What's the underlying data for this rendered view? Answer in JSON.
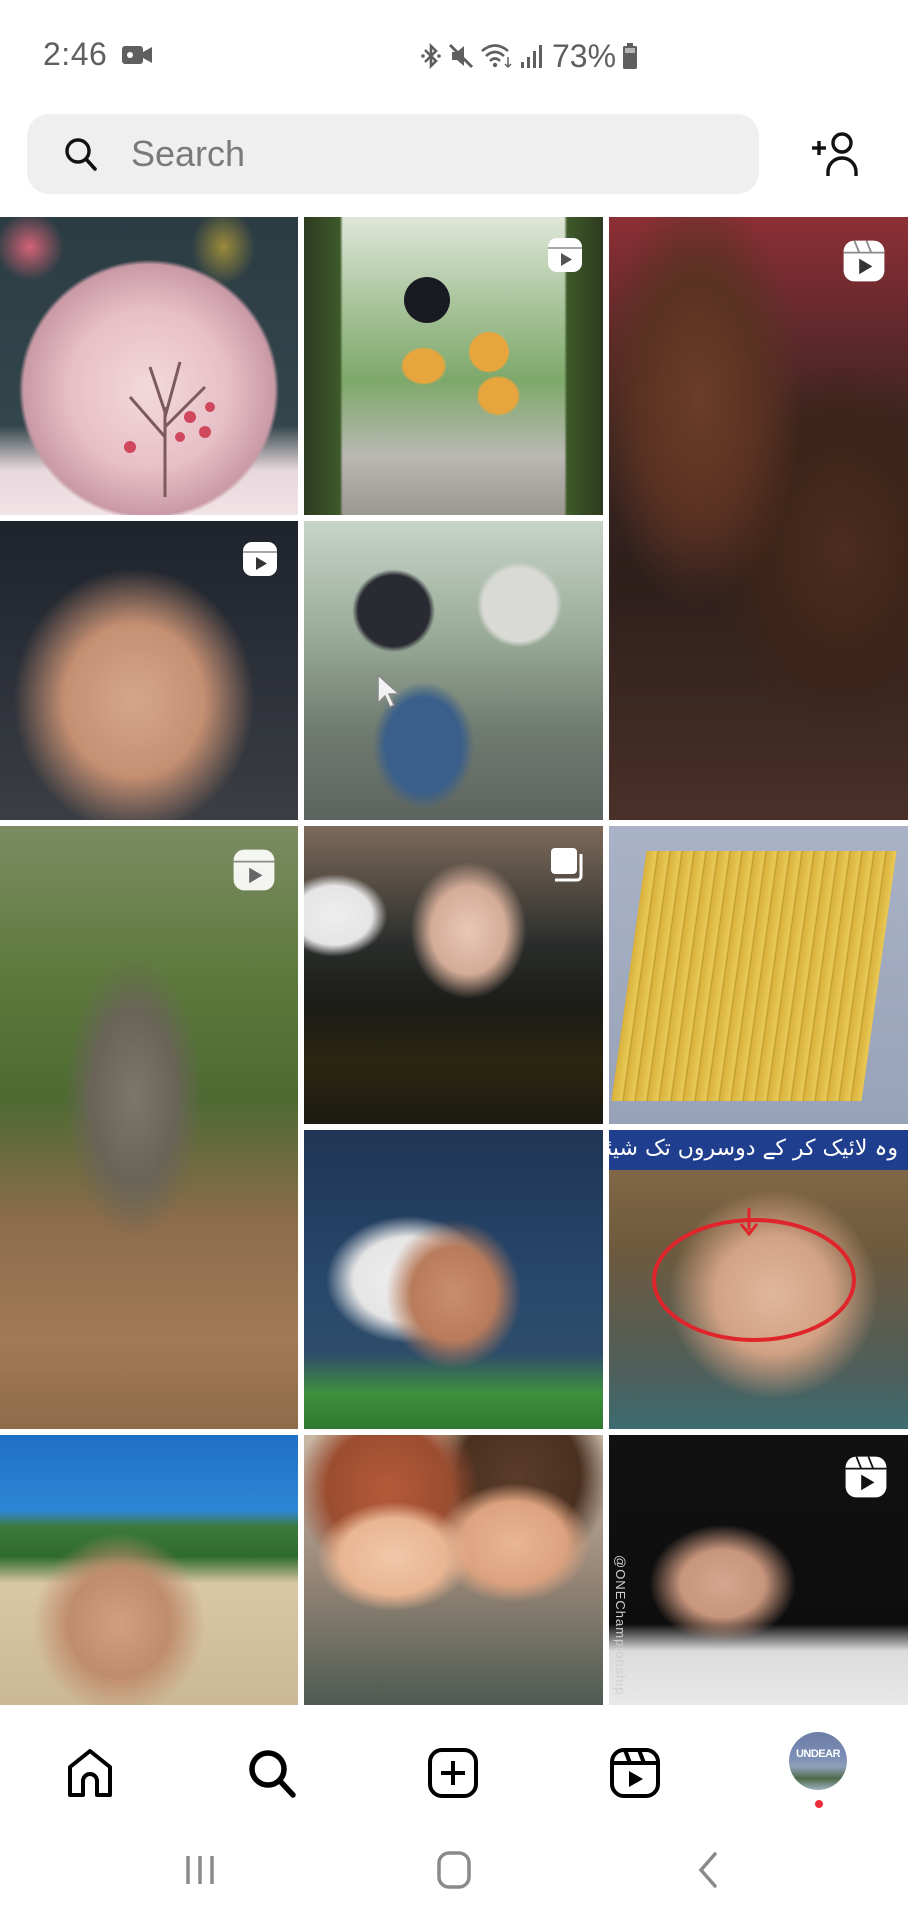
{
  "status_bar": {
    "time": "2:46",
    "battery_percent": "73%",
    "icons": [
      "video-recording-icon",
      "bluetooth-icon",
      "mute-icon",
      "wifi-icon",
      "signal-icon",
      "battery-icon"
    ]
  },
  "search": {
    "placeholder": "Search",
    "value": ""
  },
  "header": {
    "add_user_icon": "add-person-icon"
  },
  "explore_grid": {
    "tiles": [
      {
        "subject": "Frosted pink apple with tree inside",
        "badge": "none"
      },
      {
        "subject": "Animated boy and girl in yellow hoodies walking",
        "badge": "reel"
      },
      {
        "subject": "Smiling woman with child",
        "badge": "reel"
      },
      {
        "subject": "Shirtless man in gym",
        "badge": "reel"
      },
      {
        "subject": "Animated boy and girl sitting on steps",
        "badge": "none"
      },
      {
        "subject": "Person in camouflage digging in forest",
        "badge": "reel"
      },
      {
        "subject": "Woman in embroidered dress taking selfie",
        "badge": "carousel"
      },
      {
        "subject": "Stack of gold bars on pallet",
        "badge": "none"
      },
      {
        "subject": "Footballer in black and white jersey",
        "badge": "none"
      },
      {
        "subject": "Child with red circle annotation",
        "badge": "none",
        "caption": "وہ لائیک کر کے دوسروں تک شیئر کریں"
      },
      {
        "subject": "Boy sitting on beach",
        "badge": "none"
      },
      {
        "subject": "Animated girl and boy portrait",
        "badge": "none"
      },
      {
        "subject": "Fighter in cage",
        "badge": "reel",
        "side_text": "@ONEChampionship"
      }
    ]
  },
  "bottom_nav": {
    "items": [
      {
        "name": "home",
        "icon": "home-icon",
        "active": false
      },
      {
        "name": "search",
        "icon": "search-icon",
        "active": true
      },
      {
        "name": "create",
        "icon": "add-square-icon",
        "active": false
      },
      {
        "name": "reels",
        "icon": "reels-icon",
        "active": false
      },
      {
        "name": "profile",
        "icon": "avatar",
        "active": false
      }
    ],
    "avatar_text": "UNDEAR",
    "notification_dot": true,
    "notification_color": "#ed2d3c"
  },
  "system_nav": {
    "items": [
      "recents",
      "home",
      "back"
    ]
  }
}
